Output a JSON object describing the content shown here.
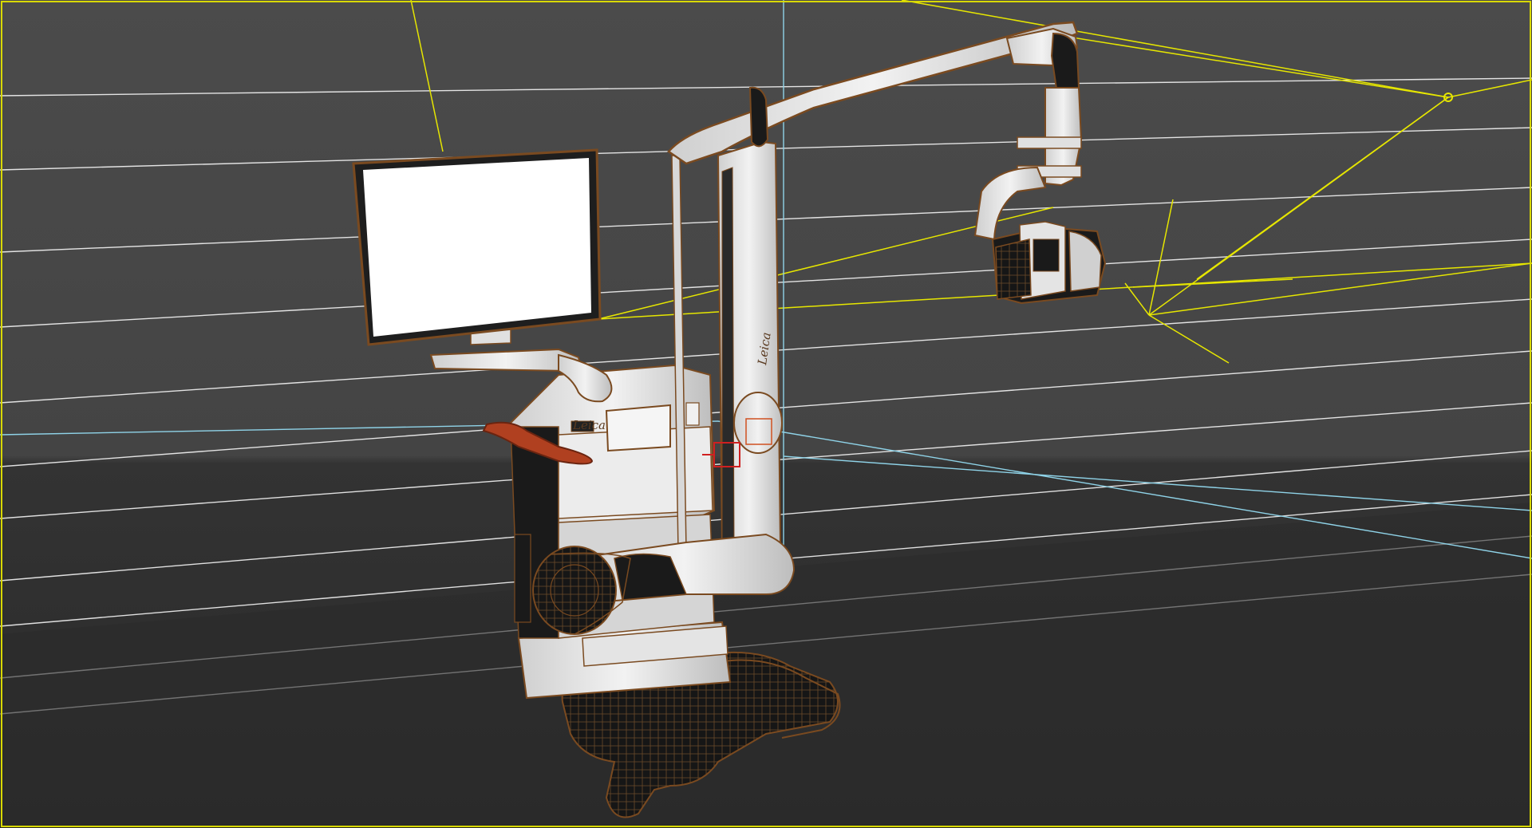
{
  "viewport": {
    "background_top": "#4a4a4a",
    "background_floor": "#2c2c2c",
    "grid_color": "#ffffff",
    "light_color": "#e6e600",
    "axis_color": "#8fd3e8",
    "selection_color": "#d02020",
    "wire_color": "#c07030"
  },
  "model": {
    "brand_label": "Leica",
    "panel_label": "Leica",
    "monitor_screen_color": "#ffffff",
    "body_color": "#e8e8e8",
    "dark_part_color": "#1a1a1a",
    "handle_color": "#b04020"
  }
}
